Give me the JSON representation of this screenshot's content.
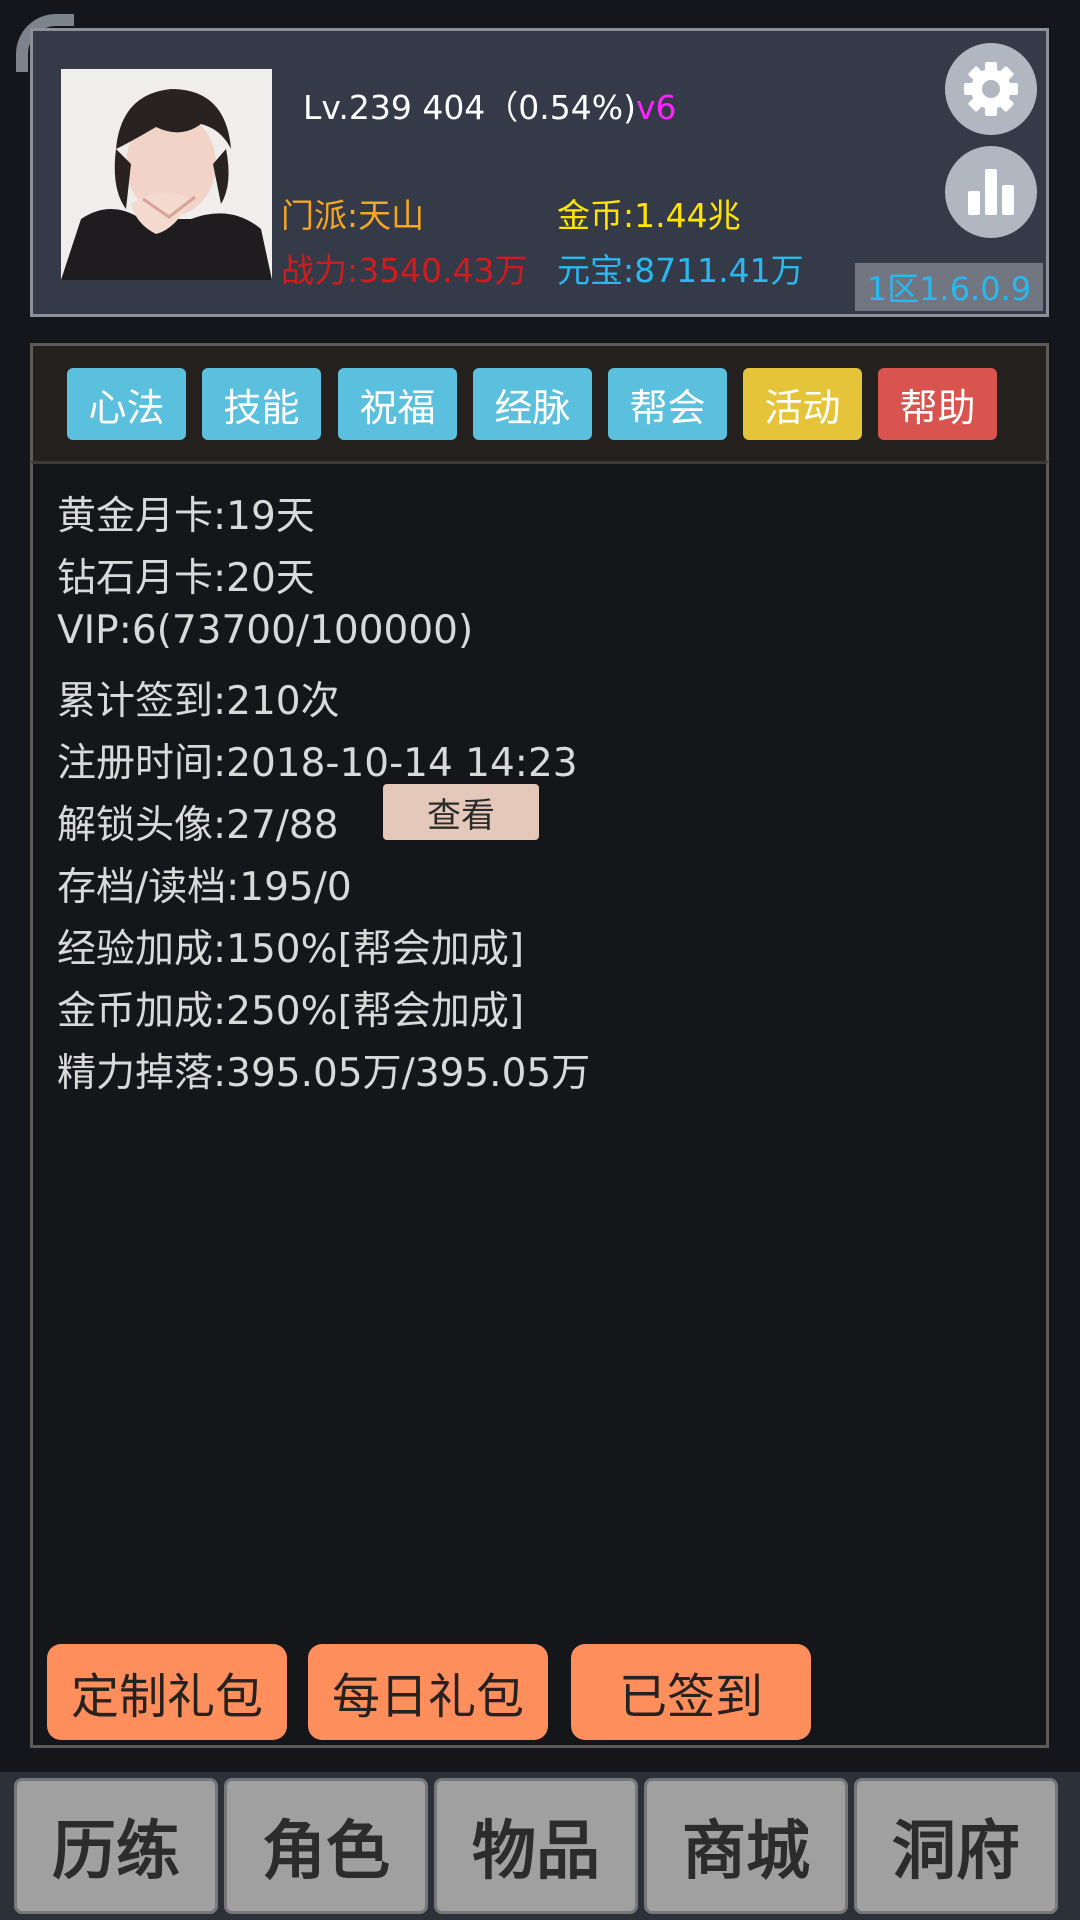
{
  "header": {
    "level_text": "Lv.239 404（0.54%)",
    "vip_tag": "v6",
    "sect": "门派:天山",
    "power": "战力:3540.43万",
    "gold": "金币:1.44兆",
    "yuanbao": "元宝:8711.41万",
    "version": "1区1.6.0.9",
    "icons": {
      "settings": "gear-icon",
      "stats": "bar-chart-icon"
    }
  },
  "tabs": [
    {
      "label": "心法",
      "color": "#5bc0de"
    },
    {
      "label": "技能",
      "color": "#5bc0de"
    },
    {
      "label": "祝福",
      "color": "#5bc0de"
    },
    {
      "label": "经脉",
      "color": "#5bc0de"
    },
    {
      "label": "帮会",
      "color": "#5bc0de"
    },
    {
      "label": "活动",
      "color": "#e6c43a"
    },
    {
      "label": "帮助",
      "color": "#d9534f"
    }
  ],
  "info": {
    "gold_card": "黄金月卡:19天",
    "diamond_card": "钻石月卡:20天",
    "vip": "VIP:6(73700/100000)",
    "signin_total": "累计签到:210次",
    "register_time": "注册时间:2018-10-14 14:23",
    "avatars_unlocked": "解锁头像:27/88",
    "view_button": "查看",
    "save_load": "存档/读档:195/0",
    "exp_bonus": "经验加成:150%[帮会加成]",
    "gold_bonus": "金币加成:250%[帮会加成]",
    "energy_drop": "精力掉落:395.05万/395.05万"
  },
  "actions": {
    "custom_pack": "定制礼包",
    "daily_pack": "每日礼包",
    "signed_in": "已签到"
  },
  "nav": [
    "历练",
    "角色",
    "物品",
    "商城",
    "洞府"
  ]
}
